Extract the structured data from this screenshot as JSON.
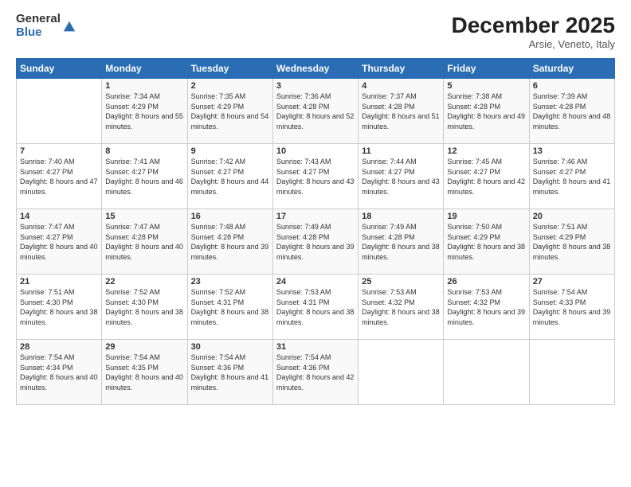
{
  "logo": {
    "general": "General",
    "blue": "Blue"
  },
  "title": "December 2025",
  "location": "Arsie, Veneto, Italy",
  "weekdays": [
    "Sunday",
    "Monday",
    "Tuesday",
    "Wednesday",
    "Thursday",
    "Friday",
    "Saturday"
  ],
  "weeks": [
    [
      {
        "num": "",
        "sunrise": "",
        "sunset": "",
        "daylight": ""
      },
      {
        "num": "1",
        "sunrise": "Sunrise: 7:34 AM",
        "sunset": "Sunset: 4:29 PM",
        "daylight": "Daylight: 8 hours and 55 minutes."
      },
      {
        "num": "2",
        "sunrise": "Sunrise: 7:35 AM",
        "sunset": "Sunset: 4:29 PM",
        "daylight": "Daylight: 8 hours and 54 minutes."
      },
      {
        "num": "3",
        "sunrise": "Sunrise: 7:36 AM",
        "sunset": "Sunset: 4:28 PM",
        "daylight": "Daylight: 8 hours and 52 minutes."
      },
      {
        "num": "4",
        "sunrise": "Sunrise: 7:37 AM",
        "sunset": "Sunset: 4:28 PM",
        "daylight": "Daylight: 8 hours and 51 minutes."
      },
      {
        "num": "5",
        "sunrise": "Sunrise: 7:38 AM",
        "sunset": "Sunset: 4:28 PM",
        "daylight": "Daylight: 8 hours and 49 minutes."
      },
      {
        "num": "6",
        "sunrise": "Sunrise: 7:39 AM",
        "sunset": "Sunset: 4:28 PM",
        "daylight": "Daylight: 8 hours and 48 minutes."
      }
    ],
    [
      {
        "num": "7",
        "sunrise": "Sunrise: 7:40 AM",
        "sunset": "Sunset: 4:27 PM",
        "daylight": "Daylight: 8 hours and 47 minutes."
      },
      {
        "num": "8",
        "sunrise": "Sunrise: 7:41 AM",
        "sunset": "Sunset: 4:27 PM",
        "daylight": "Daylight: 8 hours and 46 minutes."
      },
      {
        "num": "9",
        "sunrise": "Sunrise: 7:42 AM",
        "sunset": "Sunset: 4:27 PM",
        "daylight": "Daylight: 8 hours and 44 minutes."
      },
      {
        "num": "10",
        "sunrise": "Sunrise: 7:43 AM",
        "sunset": "Sunset: 4:27 PM",
        "daylight": "Daylight: 8 hours and 43 minutes."
      },
      {
        "num": "11",
        "sunrise": "Sunrise: 7:44 AM",
        "sunset": "Sunset: 4:27 PM",
        "daylight": "Daylight: 8 hours and 43 minutes."
      },
      {
        "num": "12",
        "sunrise": "Sunrise: 7:45 AM",
        "sunset": "Sunset: 4:27 PM",
        "daylight": "Daylight: 8 hours and 42 minutes."
      },
      {
        "num": "13",
        "sunrise": "Sunrise: 7:46 AM",
        "sunset": "Sunset: 4:27 PM",
        "daylight": "Daylight: 8 hours and 41 minutes."
      }
    ],
    [
      {
        "num": "14",
        "sunrise": "Sunrise: 7:47 AM",
        "sunset": "Sunset: 4:27 PM",
        "daylight": "Daylight: 8 hours and 40 minutes."
      },
      {
        "num": "15",
        "sunrise": "Sunrise: 7:47 AM",
        "sunset": "Sunset: 4:28 PM",
        "daylight": "Daylight: 8 hours and 40 minutes."
      },
      {
        "num": "16",
        "sunrise": "Sunrise: 7:48 AM",
        "sunset": "Sunset: 4:28 PM",
        "daylight": "Daylight: 8 hours and 39 minutes."
      },
      {
        "num": "17",
        "sunrise": "Sunrise: 7:49 AM",
        "sunset": "Sunset: 4:28 PM",
        "daylight": "Daylight: 8 hours and 39 minutes."
      },
      {
        "num": "18",
        "sunrise": "Sunrise: 7:49 AM",
        "sunset": "Sunset: 4:28 PM",
        "daylight": "Daylight: 8 hours and 38 minutes."
      },
      {
        "num": "19",
        "sunrise": "Sunrise: 7:50 AM",
        "sunset": "Sunset: 4:29 PM",
        "daylight": "Daylight: 8 hours and 38 minutes."
      },
      {
        "num": "20",
        "sunrise": "Sunrise: 7:51 AM",
        "sunset": "Sunset: 4:29 PM",
        "daylight": "Daylight: 8 hours and 38 minutes."
      }
    ],
    [
      {
        "num": "21",
        "sunrise": "Sunrise: 7:51 AM",
        "sunset": "Sunset: 4:30 PM",
        "daylight": "Daylight: 8 hours and 38 minutes."
      },
      {
        "num": "22",
        "sunrise": "Sunrise: 7:52 AM",
        "sunset": "Sunset: 4:30 PM",
        "daylight": "Daylight: 8 hours and 38 minutes."
      },
      {
        "num": "23",
        "sunrise": "Sunrise: 7:52 AM",
        "sunset": "Sunset: 4:31 PM",
        "daylight": "Daylight: 8 hours and 38 minutes."
      },
      {
        "num": "24",
        "sunrise": "Sunrise: 7:53 AM",
        "sunset": "Sunset: 4:31 PM",
        "daylight": "Daylight: 8 hours and 38 minutes."
      },
      {
        "num": "25",
        "sunrise": "Sunrise: 7:53 AM",
        "sunset": "Sunset: 4:32 PM",
        "daylight": "Daylight: 8 hours and 38 minutes."
      },
      {
        "num": "26",
        "sunrise": "Sunrise: 7:53 AM",
        "sunset": "Sunset: 4:32 PM",
        "daylight": "Daylight: 8 hours and 39 minutes."
      },
      {
        "num": "27",
        "sunrise": "Sunrise: 7:54 AM",
        "sunset": "Sunset: 4:33 PM",
        "daylight": "Daylight: 8 hours and 39 minutes."
      }
    ],
    [
      {
        "num": "28",
        "sunrise": "Sunrise: 7:54 AM",
        "sunset": "Sunset: 4:34 PM",
        "daylight": "Daylight: 8 hours and 40 minutes."
      },
      {
        "num": "29",
        "sunrise": "Sunrise: 7:54 AM",
        "sunset": "Sunset: 4:35 PM",
        "daylight": "Daylight: 8 hours and 40 minutes."
      },
      {
        "num": "30",
        "sunrise": "Sunrise: 7:54 AM",
        "sunset": "Sunset: 4:36 PM",
        "daylight": "Daylight: 8 hours and 41 minutes."
      },
      {
        "num": "31",
        "sunrise": "Sunrise: 7:54 AM",
        "sunset": "Sunset: 4:36 PM",
        "daylight": "Daylight: 8 hours and 42 minutes."
      },
      {
        "num": "",
        "sunrise": "",
        "sunset": "",
        "daylight": ""
      },
      {
        "num": "",
        "sunrise": "",
        "sunset": "",
        "daylight": ""
      },
      {
        "num": "",
        "sunrise": "",
        "sunset": "",
        "daylight": ""
      }
    ]
  ]
}
